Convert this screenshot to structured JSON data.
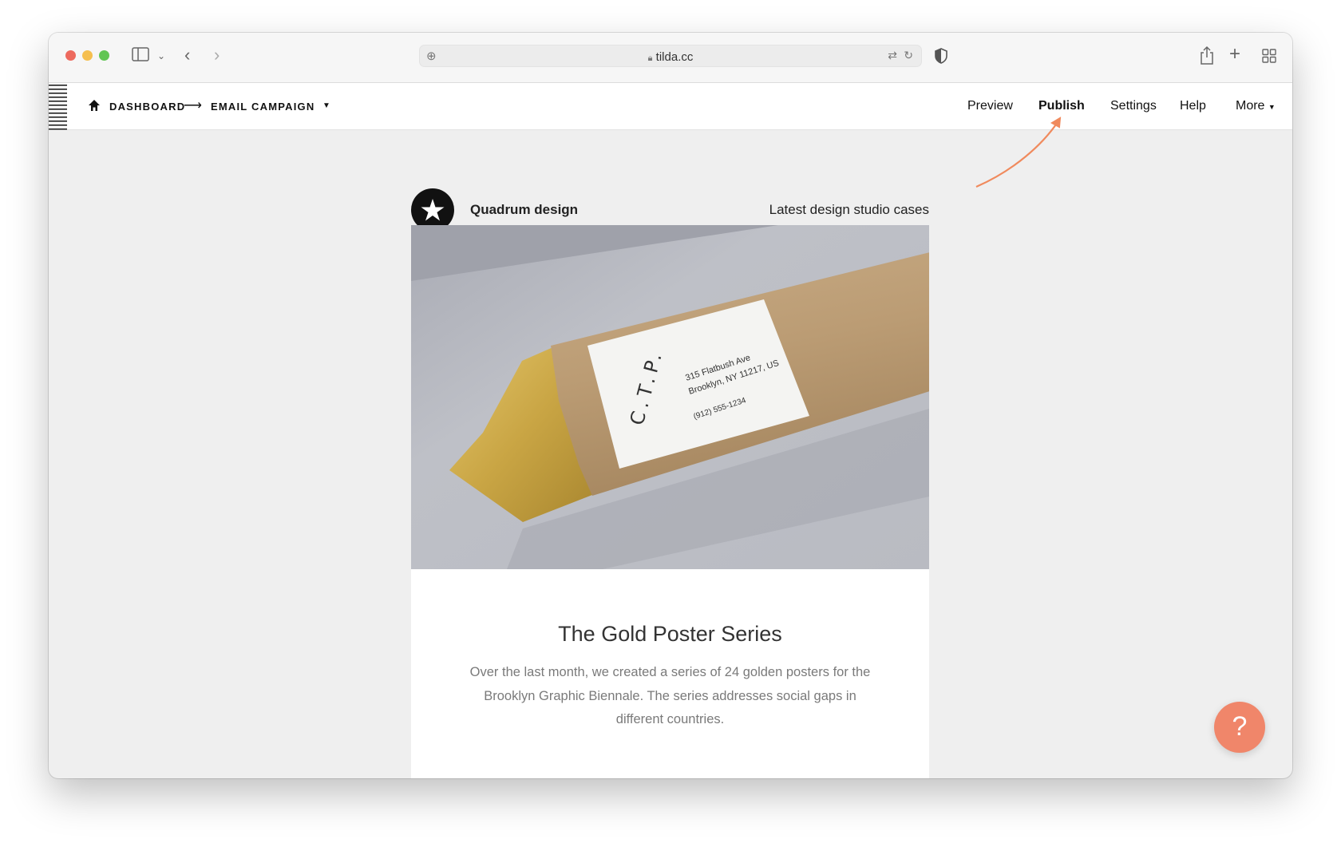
{
  "browser": {
    "url": "tilda.cc",
    "traffic_colors": [
      "#ed6a5e",
      "#f5bf4f",
      "#61c554"
    ]
  },
  "header": {
    "breadcrumb": [
      "DASHBOARD",
      "EMAIL CAMPAIGN"
    ],
    "nav": [
      "Preview",
      "Publish",
      "Settings",
      "Help",
      "More"
    ],
    "active_nav": "Publish"
  },
  "email": {
    "brand": "Quadrum design",
    "tagline": "Latest design studio cases",
    "image": {
      "label_logo": "C.T.P.",
      "label_address_1": "315 Flatbush Ave",
      "label_address_2": "Brooklyn, NY 11217, US",
      "label_phone": "(912) 555-1234"
    },
    "title": "The Gold Poster Series",
    "body": "Over the last month, we created a series of 24 golden posters for the Brooklyn Graphic Biennale. The series addresses social gaps in different countries."
  },
  "help_button": {
    "label": "?",
    "color": "#f0866a"
  },
  "annotation_color": "#f08a5d"
}
